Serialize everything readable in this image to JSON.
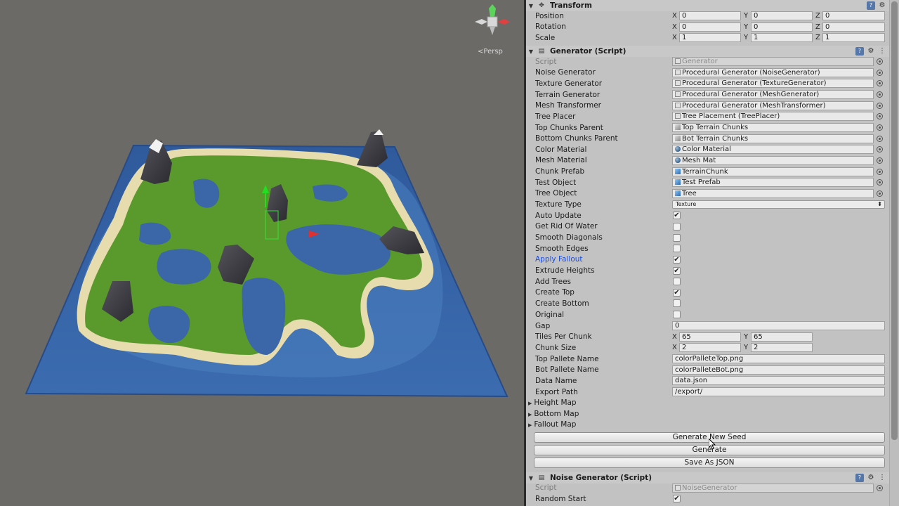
{
  "scene": {
    "persp_label": "Persp",
    "water_color": "#3b66a8",
    "grass_color": "#5a9a2c",
    "sand_color": "#e6dcae",
    "rock_color": "#3a3a3f",
    "background_color": "#6c6a67"
  },
  "transform": {
    "title": "Transform",
    "rows": [
      {
        "label": "Position",
        "x": "0",
        "y": "0",
        "z": "0"
      },
      {
        "label": "Rotation",
        "x": "0",
        "y": "0",
        "z": "0"
      },
      {
        "label": "Scale",
        "x": "1",
        "y": "1",
        "z": "1"
      }
    ]
  },
  "generator": {
    "title": "Generator (Script)",
    "script_label": "Script",
    "script_value": "Generator",
    "refs": [
      {
        "label": "Noise Generator",
        "value": "Procedural Generator (NoiseGenerator)",
        "icon": "script"
      },
      {
        "label": "Texture Generator",
        "value": "Procedural Generator (TextureGenerator)",
        "icon": "script"
      },
      {
        "label": "Terrain Generator",
        "value": "Procedural Generator (MeshGenerator)",
        "icon": "script"
      },
      {
        "label": "Mesh Transformer",
        "value": "Procedural Generator (MeshTransformer)",
        "icon": "script"
      },
      {
        "label": "Tree Placer",
        "value": "Tree Placement (TreePlacer)",
        "icon": "script"
      },
      {
        "label": "Top Chunks Parent",
        "value": "Top Terrain Chunks",
        "icon": "go"
      },
      {
        "label": "Bottom Chunks Parent",
        "value": "Bot Terrain Chunks",
        "icon": "go"
      },
      {
        "label": "Color Material",
        "value": "Color Material",
        "icon": "sphere"
      },
      {
        "label": "Mesh Material",
        "value": "Mesh Mat",
        "icon": "sphere"
      },
      {
        "label": "Chunk Prefab",
        "value": "TerrainChunk",
        "icon": "cube"
      },
      {
        "label": "Test Object",
        "value": "Test Prefab",
        "icon": "cube"
      },
      {
        "label": "Tree Object",
        "value": "Tree",
        "icon": "cube"
      }
    ],
    "texture_type_label": "Texture Type",
    "texture_type_value": "Texture",
    "toggles": [
      {
        "label": "Auto Update",
        "checked": true,
        "highlight": false
      },
      {
        "label": "Get Rid Of Water",
        "checked": false,
        "highlight": false
      },
      {
        "label": "Smooth Diagonals",
        "checked": false,
        "highlight": false
      },
      {
        "label": "Smooth Edges",
        "checked": false,
        "highlight": false
      },
      {
        "label": "Apply Fallout",
        "checked": true,
        "highlight": true
      },
      {
        "label": "Extrude Heights",
        "checked": true,
        "highlight": false
      },
      {
        "label": "Add Trees",
        "checked": false,
        "highlight": false
      },
      {
        "label": "Create Top",
        "checked": true,
        "highlight": false
      },
      {
        "label": "Create Bottom",
        "checked": false,
        "highlight": false
      },
      {
        "label": "Original",
        "checked": false,
        "highlight": false
      }
    ],
    "gap_label": "Gap",
    "gap_value": "0",
    "tiles_label": "Tiles Per Chunk",
    "tiles_x": "65",
    "tiles_y": "65",
    "chunk_size_label": "Chunk Size",
    "chunk_size_x": "2",
    "chunk_size_y": "2",
    "texts": [
      {
        "label": "Top Pallete Name",
        "value": "colorPalleteTop.png"
      },
      {
        "label": "Bot Pallete Name",
        "value": "colorPalleteBot.png"
      },
      {
        "label": "Data Name",
        "value": "data.json"
      },
      {
        "label": "Export Path",
        "value": "/export/"
      }
    ],
    "foldouts": [
      "Height Map",
      "Bottom Map",
      "Fallout Map"
    ],
    "buttons": [
      "Generate New Seed",
      "Generate",
      "Save As JSON"
    ]
  },
  "noise": {
    "title": "Noise Generator (Script)",
    "script_label": "Script",
    "script_value": "NoiseGenerator",
    "random_start_label": "Random Start",
    "random_start_checked": true
  },
  "axes": {
    "x": "X",
    "y": "Y",
    "z": "Z"
  }
}
